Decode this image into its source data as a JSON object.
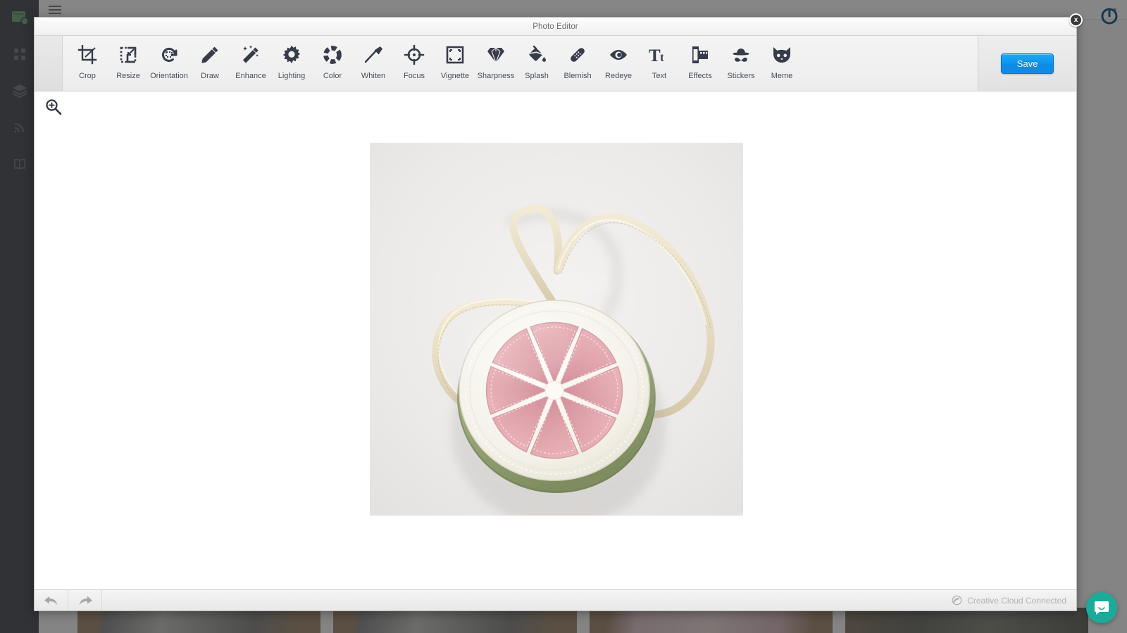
{
  "background": {
    "sidebar": {
      "items": [
        {
          "name": "logo-icon",
          "label": "Logo"
        },
        {
          "name": "grid-icon",
          "label": "Dashboard"
        },
        {
          "name": "layers-icon",
          "label": "Layers"
        },
        {
          "name": "rss-icon",
          "label": "Feed"
        },
        {
          "name": "book-icon",
          "label": "Library"
        }
      ]
    },
    "thumbnails": [
      {
        "name": "thumbnail-1",
        "variant": "default"
      },
      {
        "name": "thumbnail-2",
        "variant": "default"
      },
      {
        "name": "thumbnail-3",
        "variant": "pink"
      },
      {
        "name": "thumbnail-4",
        "variant": "dark"
      }
    ]
  },
  "power_icon": "power-icon",
  "modal": {
    "title": "Photo Editor",
    "close_label": "x",
    "toolbar": {
      "tools": [
        {
          "label": "Crop",
          "icon": "crop-icon"
        },
        {
          "label": "Resize",
          "icon": "resize-icon"
        },
        {
          "label": "Orientation",
          "icon": "orientation-icon"
        },
        {
          "label": "Draw",
          "icon": "pencil-icon"
        },
        {
          "label": "Enhance",
          "icon": "magic-wand-icon"
        },
        {
          "label": "Lighting",
          "icon": "sun-icon"
        },
        {
          "label": "Color",
          "icon": "color-wheel-icon"
        },
        {
          "label": "Whiten",
          "icon": "toothbrush-icon"
        },
        {
          "label": "Focus",
          "icon": "focus-target-icon"
        },
        {
          "label": "Vignette",
          "icon": "vignette-frame-icon"
        },
        {
          "label": "Sharpness",
          "icon": "diamond-icon"
        },
        {
          "label": "Splash",
          "icon": "paint-bucket-icon"
        },
        {
          "label": "Blemish",
          "icon": "bandage-icon"
        },
        {
          "label": "Redeye",
          "icon": "eye-icon"
        },
        {
          "label": "Text",
          "icon": "text-tt-icon"
        },
        {
          "label": "Effects",
          "icon": "film-roll-icon"
        },
        {
          "label": "Stickers",
          "icon": "hat-mustache-icon"
        },
        {
          "label": "Meme",
          "icon": "cat-face-icon"
        }
      ],
      "save_label": "Save"
    },
    "canvas": {
      "zoom_tool": "zoom-in-icon",
      "photo_alt": "Pink citrus slice fabric crossbody purse with cream cord strap"
    },
    "footer": {
      "undo_label": "Undo",
      "redo_label": "Redo",
      "status_text": "Creative Cloud Connected"
    }
  },
  "intercom": {
    "label": "Open messenger"
  },
  "colors": {
    "accent_blue": "#0b94ee",
    "sidebar_dark": "#1e222c",
    "logo_green": "#4f9a5f",
    "intercom_teal": "#1aab9b",
    "power_blue": "#17374f"
  }
}
